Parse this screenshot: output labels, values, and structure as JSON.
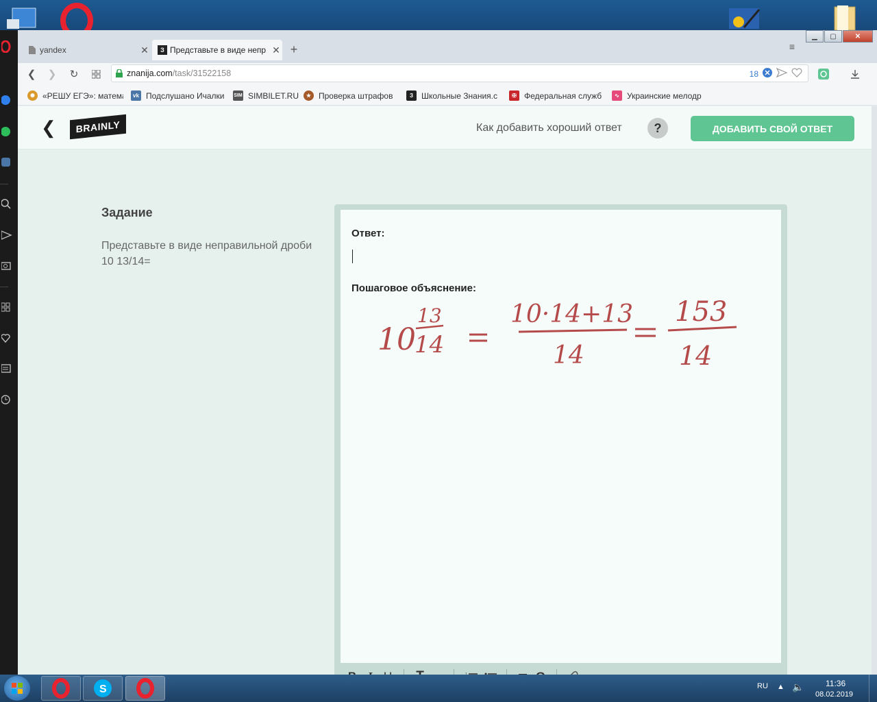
{
  "tabs": [
    {
      "label": "yandex",
      "icon": "page-icon",
      "active": false
    },
    {
      "label": "Представьте в виде непр",
      "icon": "znanija-icon",
      "active": true
    }
  ],
  "address": {
    "host": "znanija.com",
    "path": "/task/31522158",
    "badge_count": "18"
  },
  "bookmarks": [
    {
      "label": "«РЕШУ ЕГЭ»: матема",
      "icon": "reshu-ege-icon"
    },
    {
      "label": "Подслушано Ичалки",
      "icon": "vk-icon"
    },
    {
      "label": "SIMBILET.RU",
      "icon": "simbilet-icon"
    },
    {
      "label": "Проверка штрафов",
      "icon": "gibdd-icon"
    },
    {
      "label": "Школьные Знания.c",
      "icon": "znanija-icon"
    },
    {
      "label": "Федеральная служб",
      "icon": "fed-service-icon"
    },
    {
      "label": "Украинские мелодр",
      "icon": "ua-melodrama-icon"
    }
  ],
  "header": {
    "logo": "BRAINLY",
    "howto": "Как добавить хороший ответ",
    "help": "?",
    "add_answer": "ДОБАВИТЬ СВОЙ ОТВЕТ"
  },
  "task": {
    "heading": "Задание",
    "text": "Представьте в виде неправильной дроби 10 13/14="
  },
  "editor": {
    "answer_label": "Ответ:",
    "explanation_label": "Пошаговое объяснение:",
    "handwritten": {
      "whole": "10",
      "num": "13",
      "den": "14",
      "expr_num": "10·14+13",
      "expr_den": "14",
      "result_num": "153",
      "result_den": "14"
    },
    "toolbar": [
      "B",
      "I",
      "U",
      "T",
      "т",
      "ordered-list",
      "bullet-list",
      "π",
      "Ω",
      "attach"
    ]
  },
  "taskbar": {
    "lang": "RU",
    "time": "11:36",
    "date": "08.02.2019"
  },
  "colors": {
    "accent": "#5fc592",
    "ink": "#b54a4a"
  }
}
